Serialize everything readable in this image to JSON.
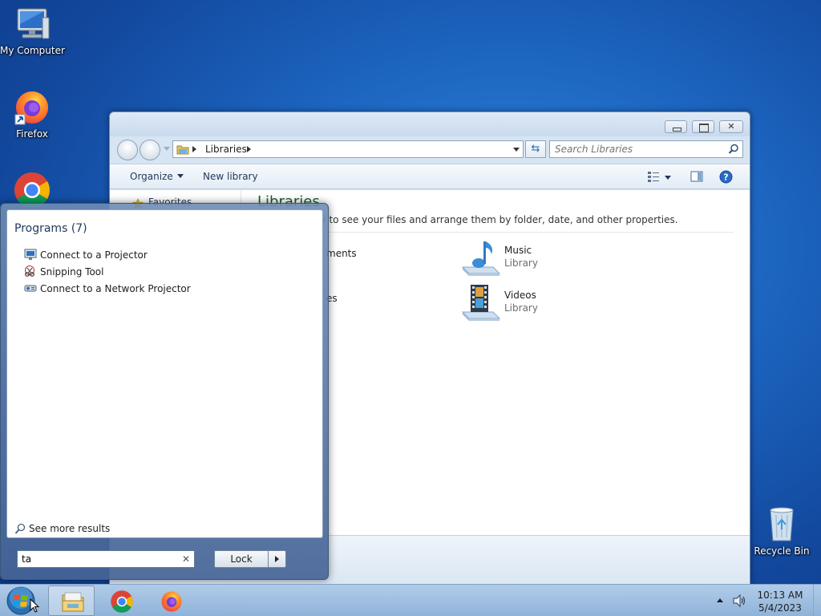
{
  "desktop": {
    "icons": [
      {
        "label": "My Computer"
      },
      {
        "label": "Firefox"
      },
      {
        "label": "Recycle Bin"
      }
    ]
  },
  "explorer": {
    "breadcrumb": "Libraries",
    "search_placeholder": "Search Libraries",
    "toolbar": {
      "organize": "Organize",
      "new_library": "New library"
    },
    "nav_favorites": "Favorites",
    "heading": "Libraries",
    "description": "Open a library to see your files and arrange them by folder, date, and other properties.",
    "partial_items": [
      "ments",
      "es"
    ],
    "libraries": [
      {
        "name": "Music",
        "type": "Library",
        "icon": "music-library-icon"
      },
      {
        "name": "Videos",
        "type": "Library",
        "icon": "videos-library-icon"
      }
    ]
  },
  "start_menu": {
    "section_title": "Programs (7)",
    "programs": [
      {
        "label": "Connect to a Projector",
        "icon": "projector-icon"
      },
      {
        "label": "Snipping Tool",
        "icon": "scissors-icon"
      },
      {
        "label": "Connect to a Network Projector",
        "icon": "network-projector-icon"
      }
    ],
    "see_more": "See more results",
    "search_value": "ta",
    "lock_label": "Lock"
  },
  "taskbar": {
    "time": "10:13 AM",
    "date": "5/4/2023"
  }
}
